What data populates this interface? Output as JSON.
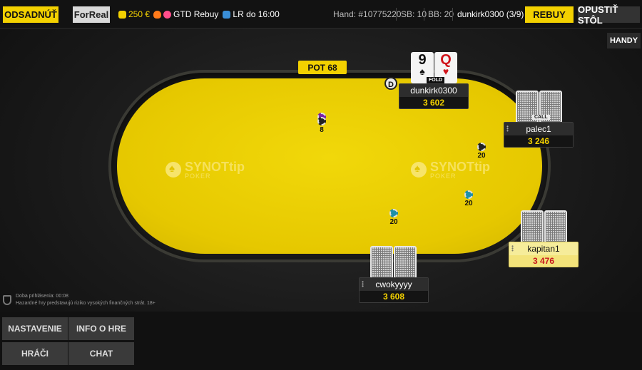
{
  "topbar": {
    "sit_out_label": "ODSADNÚŤ",
    "mode_label": "ForReal",
    "balance": "250 €",
    "tournament_name": "GTD Rebuy",
    "lr_text": "LR do 16:00",
    "hand_label": "Hand: #10775220",
    "sb_label": "SB: 10",
    "bb_label": "BB: 20",
    "user_info": "dunkirk0300 (3/9)",
    "rebuy_label": "REBUY",
    "leave_label": "OPUSTIŤ STÔL"
  },
  "hands_button": "HANDY",
  "table": {
    "pot_label": "POT 68",
    "logo_text": "SYNOTtip",
    "logo_sub": "POKER",
    "dealer_label": "D"
  },
  "players": {
    "dunkirk": {
      "name": "dunkirk0300",
      "stack": "3 602",
      "card1_rank": "9",
      "card1_suit": "♠",
      "card2_rank": "Q",
      "card2_suit": "♥",
      "status": "FOLD"
    },
    "palec": {
      "name": "palec1",
      "stack": "3 246",
      "status": "CALL"
    },
    "kapitan": {
      "name": "kapitan1",
      "stack": "3 476"
    },
    "cwokyyyy": {
      "name": "cwokyyyy",
      "stack": "3 608"
    }
  },
  "bets": {
    "dunkirk": "8",
    "palec": "20",
    "kapitan": "20",
    "cwokyyyy": "20"
  },
  "login_info": {
    "line1": "Doba prihlásenia: 00:08",
    "line2": "Hazardné hry predstavujú riziko vysokých finančných strát. 18+"
  },
  "bottom_buttons": {
    "settings": "NASTAVENIE",
    "hand_info": "INFO O HRE",
    "players": "HRÁČI",
    "chat": "CHAT"
  },
  "colors": {
    "accent": "#f3d100",
    "felt": "#e6c800",
    "stack_text": "#f3d100",
    "active_stack_text": "#c8161d"
  }
}
